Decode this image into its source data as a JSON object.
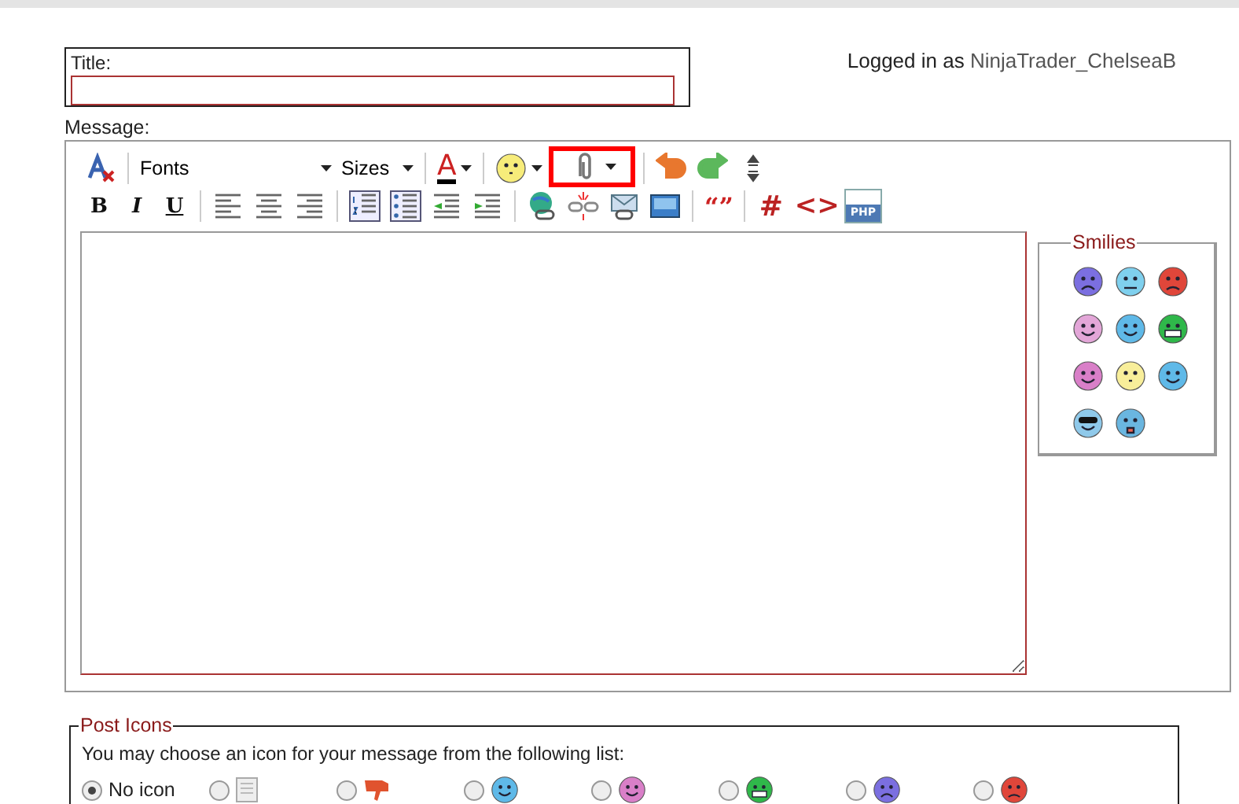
{
  "title_field": {
    "label": "Title:"
  },
  "login": {
    "prefix": "Logged in as",
    "user": "NinjaTrader_ChelseaB"
  },
  "message": {
    "label": "Message:"
  },
  "toolbar": [
    [
      {
        "kind": "clear-format"
      },
      {
        "kind": "sep"
      },
      {
        "kind": "font-select",
        "label": "Fonts"
      },
      {
        "kind": "size-select",
        "label": "Sizes"
      },
      {
        "kind": "sep"
      },
      {
        "kind": "font-color",
        "label": "A"
      },
      {
        "kind": "sep"
      },
      {
        "kind": "smiley-menu"
      },
      {
        "kind": "attach",
        "highlighted": true
      },
      {
        "kind": "sep"
      },
      {
        "kind": "undo"
      },
      {
        "kind": "redo"
      },
      {
        "kind": "resize"
      }
    ],
    [
      {
        "kind": "bold",
        "label": "B"
      },
      {
        "kind": "italic",
        "label": "I"
      },
      {
        "kind": "underline",
        "label": "U"
      },
      {
        "kind": "sep"
      },
      {
        "kind": "align-left"
      },
      {
        "kind": "align-center"
      },
      {
        "kind": "align-right"
      },
      {
        "kind": "sep"
      },
      {
        "kind": "ordered-list"
      },
      {
        "kind": "bullet-list"
      },
      {
        "kind": "outdent"
      },
      {
        "kind": "indent"
      },
      {
        "kind": "sep"
      },
      {
        "kind": "link"
      },
      {
        "kind": "unlink"
      },
      {
        "kind": "email"
      },
      {
        "kind": "image"
      },
      {
        "kind": "sep"
      },
      {
        "kind": "quote",
        "label": "“”"
      },
      {
        "kind": "sep"
      },
      {
        "kind": "code-glyph",
        "label": "#"
      },
      {
        "kind": "html",
        "label": "<>"
      },
      {
        "kind": "php",
        "label": "PHP"
      }
    ]
  ],
  "smilies": {
    "legend": "Smilies",
    "items": [
      {
        "color": "#7b6fe0",
        "kind": "sad"
      },
      {
        "color": "#7fd0ee",
        "kind": "confused"
      },
      {
        "color": "#e0463a",
        "kind": "angry"
      },
      {
        "color": "#e3a6d8",
        "kind": "tongue"
      },
      {
        "color": "#5fb9e8",
        "kind": "wink"
      },
      {
        "color": "#2fb84a",
        "kind": "grin"
      },
      {
        "color": "#d97fc8",
        "kind": "smile"
      },
      {
        "color": "#f8ee9a",
        "kind": "plain"
      },
      {
        "color": "#5fb9e8",
        "kind": "happy"
      },
      {
        "color": "#8fc9ea",
        "kind": "cool"
      },
      {
        "color": "#6ab6e0",
        "kind": "shock"
      }
    ]
  },
  "post_icons": {
    "legend": "Post Icons",
    "hint": "You may choose an icon for your message from the following list:",
    "options": [
      {
        "selected": true,
        "kind": "none",
        "label": "No icon"
      },
      {
        "selected": false,
        "kind": "document"
      },
      {
        "selected": false,
        "kind": "thumbs-down"
      },
      {
        "selected": false,
        "kind": "wink",
        "color": "#5fb9e8"
      },
      {
        "selected": false,
        "kind": "smile",
        "color": "#d97fc8"
      },
      {
        "selected": false,
        "kind": "grin",
        "color": "#2fb84a"
      },
      {
        "selected": false,
        "kind": "sad",
        "color": "#7b6fe0"
      },
      {
        "selected": false,
        "kind": "angry",
        "color": "#e0463a"
      }
    ]
  }
}
